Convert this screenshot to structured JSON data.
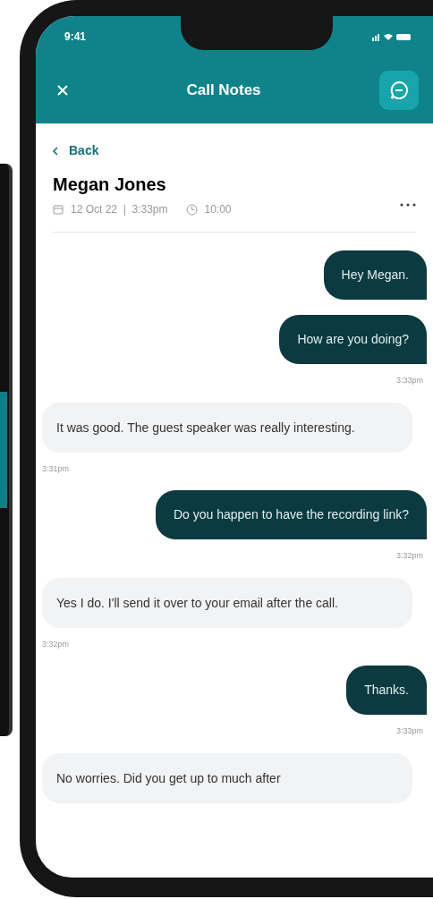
{
  "status_bar": {
    "time": "9:41"
  },
  "header": {
    "title": "Call Notes"
  },
  "back": {
    "label": "Back"
  },
  "contact": {
    "name": "Megan Jones",
    "date": "12 Oct 22  |  3:33pm",
    "duration": "10:00"
  },
  "messages": [
    {
      "kind": "sent",
      "text": "Hey Megan."
    },
    {
      "kind": "sent",
      "text": "How are you doing?",
      "time": "3:33pm"
    },
    {
      "kind": "received",
      "text": "It was good. The guest speaker was really interesting.",
      "time": "3:31pm"
    },
    {
      "kind": "sent",
      "text": "Do you happen to have the recording link?",
      "time": "3:32pm"
    },
    {
      "kind": "received",
      "text": "Yes I do. I'll send it over to your email after the call.",
      "time": "3:32pm"
    },
    {
      "kind": "sent",
      "text": "Thanks.",
      "time": "3:33pm"
    },
    {
      "kind": "received",
      "text": "No worries. Did you get up to much after"
    }
  ]
}
